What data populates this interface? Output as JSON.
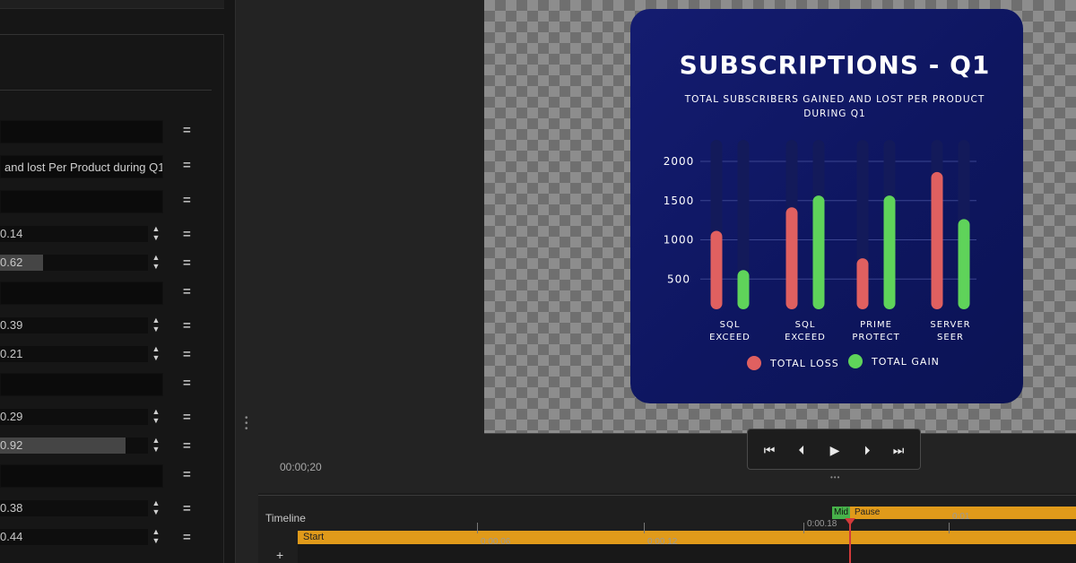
{
  "properties": {
    "rows": [
      {
        "kind": "field",
        "value": ""
      },
      {
        "kind": "field",
        "value": "and lost Per Product during Q1"
      },
      {
        "kind": "field",
        "value": ""
      },
      {
        "kind": "num",
        "value": "0.14",
        "fill": 0
      },
      {
        "kind": "num",
        "value": "0.62",
        "fill": 0.29
      },
      {
        "kind": "field",
        "value": ""
      },
      {
        "kind": "num",
        "value": "0.39",
        "fill": 0
      },
      {
        "kind": "num",
        "value": "0.21",
        "fill": 0
      },
      {
        "kind": "field",
        "value": ""
      },
      {
        "kind": "num",
        "value": "0.29",
        "fill": 0
      },
      {
        "kind": "num",
        "value": "0.92",
        "fill": 0.85
      },
      {
        "kind": "field",
        "value": ""
      },
      {
        "kind": "num",
        "value": "0.38",
        "fill": 0
      },
      {
        "kind": "num",
        "value": "0.44",
        "fill": 0
      }
    ],
    "menu_glyph": "=",
    "spin_glyph": "▲▼"
  },
  "preview": {
    "timecode": "00:00;20",
    "transport": {
      "first": "⏮",
      "prev": "⏴",
      "play": "▶",
      "next": "⏵",
      "last": "⏭"
    }
  },
  "timeline": {
    "title": "Timeline",
    "add": "+",
    "start_label": "Start",
    "mid_label": "Mid",
    "pause_label": "Pause",
    "ticks": [
      "0:00.06",
      "0:00.12",
      "0:00.18",
      "0:01"
    ]
  },
  "chart_data": {
    "type": "bar",
    "title": "SUBSCRIPTIONS - Q1",
    "subtitle": "TOTAL SUBSCRIBERS GAINED AND LOST PER PRODUCT DURING Q1",
    "categories": [
      "SQL EXCEED",
      "SQL EXCEED",
      "PRIME PROTECT",
      "SERVER SEER"
    ],
    "category_lines": [
      [
        "SQL",
        "EXCEED"
      ],
      [
        "SQL",
        "EXCEED"
      ],
      [
        "PRIME",
        "PROTECT"
      ],
      [
        "SERVER",
        "SEER"
      ]
    ],
    "series": [
      {
        "name": "TOTAL LOSS",
        "color": "#e06060",
        "values": [
          1000,
          1300,
          650,
          1750
        ]
      },
      {
        "name": "TOTAL GAIN",
        "color": "#5fd35a",
        "values": [
          500,
          1450,
          1450,
          1150
        ]
      }
    ],
    "yticks": [
      500,
      1000,
      1500,
      2000
    ],
    "ylim": [
      0,
      2000
    ],
    "grid": true,
    "legend_position": "bottom",
    "background_color": "#101866"
  }
}
